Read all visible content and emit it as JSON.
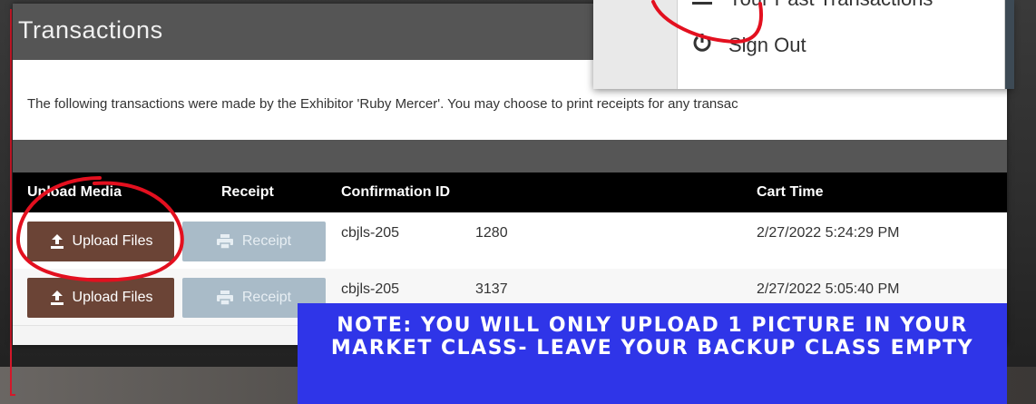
{
  "page": {
    "title": "Transactions",
    "info_text": "The following transactions were made by the Exhibitor 'Ruby Mercer'. You may choose to print receipts for any transac"
  },
  "menu": {
    "items": [
      {
        "label": "Your Past Transactions",
        "icon": "hamburger-icon"
      },
      {
        "label": "Sign Out",
        "icon": "power-icon"
      }
    ]
  },
  "table": {
    "headers": [
      "Upload Media",
      "Receipt",
      "Confirmation ID",
      "Cart Time"
    ],
    "rows": [
      {
        "upload_label": "Upload Files",
        "receipt_label": "Receipt",
        "conf_prefix": "cbjls-205",
        "conf_suffix": "1280",
        "cart_time": "2/27/2022 5:24:29 PM"
      },
      {
        "upload_label": "Upload Files",
        "receipt_label": "Receipt",
        "conf_prefix": "cbjls-205",
        "conf_suffix": "3137",
        "cart_time": "2/27/2022 5:05:40 PM"
      }
    ]
  },
  "note": {
    "text": "Note: You will only upload 1 picture in your market class- leave your backup class empty"
  },
  "colors": {
    "upload_button": "#6b4436",
    "receipt_button": "#a9bbc8",
    "note_banner": "#2f35e8",
    "annotation_red": "#e3101f"
  }
}
